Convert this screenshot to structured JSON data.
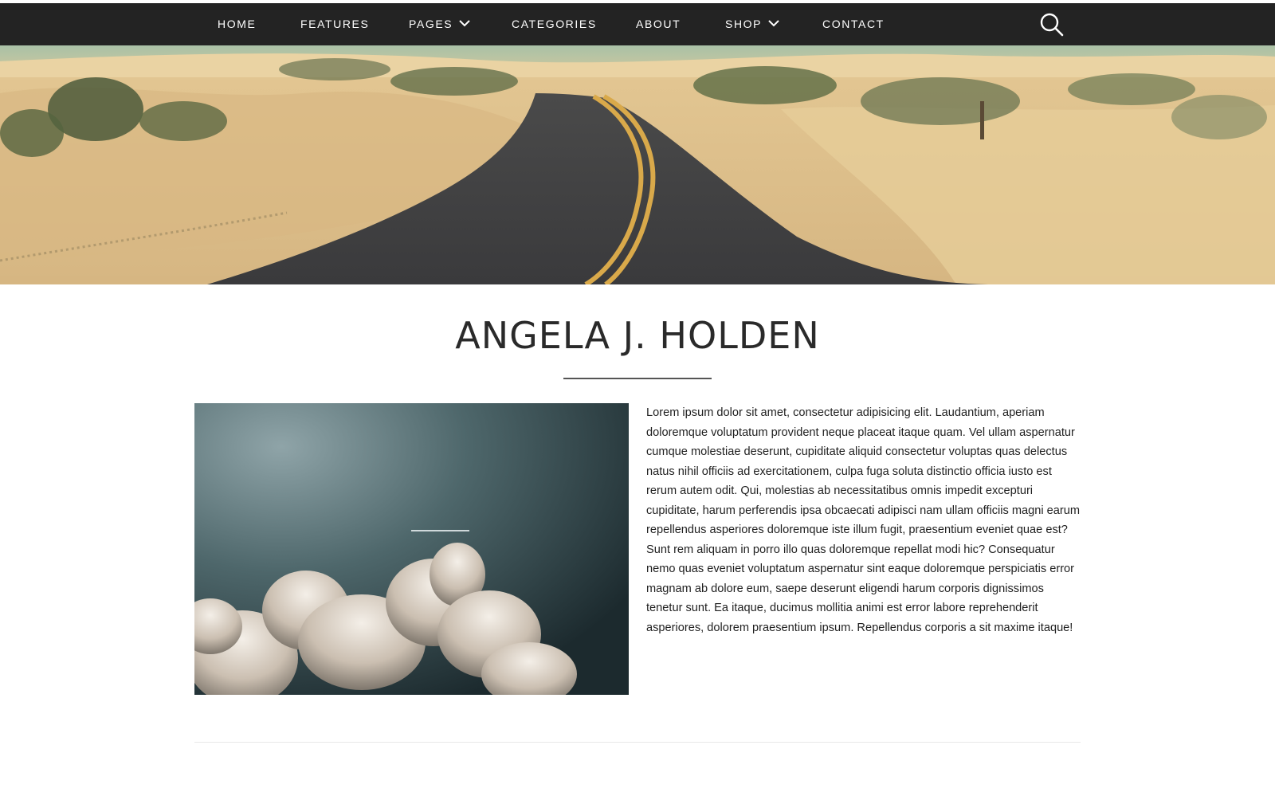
{
  "nav": {
    "items": [
      {
        "label": "HOME",
        "has_dropdown": false
      },
      {
        "label": "FEATURES",
        "has_dropdown": false
      },
      {
        "label": "PAGES",
        "has_dropdown": true
      },
      {
        "label": "CATEGORIES",
        "has_dropdown": false
      },
      {
        "label": "ABOUT",
        "has_dropdown": false
      },
      {
        "label": "SHOP",
        "has_dropdown": true
      },
      {
        "label": "CONTACT",
        "has_dropdown": false
      }
    ],
    "search_icon": "search-icon",
    "background_color": "#232323",
    "text_color": "#ffffff"
  },
  "hero": {
    "image": "desert-road-banner"
  },
  "profile": {
    "name": "ANGELA J. HOLDEN",
    "photo": "sky-cloud-photo",
    "bio": "Lorem ipsum dolor sit amet, consectetur adipisicing elit. Laudantium, aperiam doloremque voluptatum provident neque placeat itaque quam. Vel ullam aspernatur cumque molestiae deserunt, cupiditate aliquid consectetur voluptas quas delectus natus nihil officiis ad exercitationem, culpa fuga soluta distinctio officia iusto est rerum autem odit. Qui, molestias ab necessitatibus omnis impedit excepturi cupiditate, harum perferendis ipsa obcaecati adipisci nam ullam officiis magni earum repellendus asperiores doloremque iste illum fugit, praesentium eveniet quae est? Sunt rem aliquam in porro illo quas doloremque repellat modi hic? Consequatur nemo quas eveniet voluptatum aspernatur sint eaque doloremque perspiciatis error magnam ab dolore eum, saepe deserunt eligendi harum corporis dignissimos tenetur sunt. Ea itaque, ducimus mollitia animi est error labore reprehenderit asperiores, dolorem praesentium ipsum. Repellendus corporis a sit maxime itaque!"
  }
}
